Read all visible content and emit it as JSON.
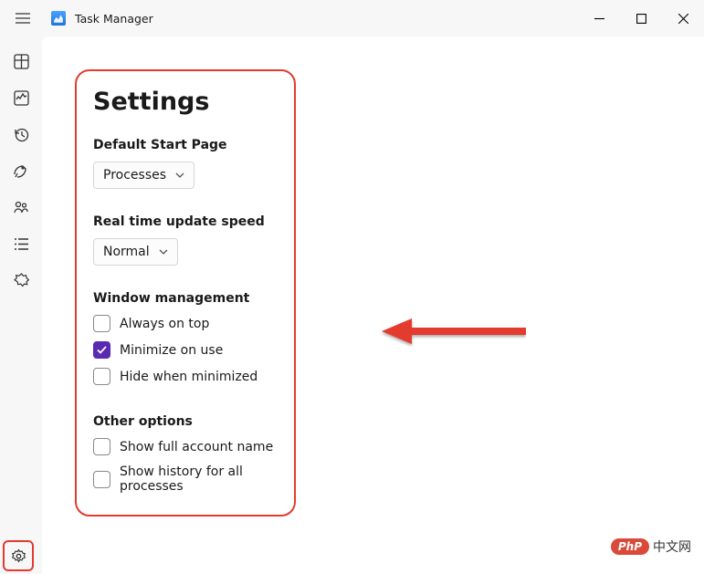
{
  "title": "Task Manager",
  "settings": {
    "heading": "Settings",
    "defaultStart": {
      "label": "Default Start Page",
      "value": "Processes"
    },
    "updateSpeed": {
      "label": "Real time update speed",
      "value": "Normal"
    },
    "windowMgmt": {
      "label": "Window management",
      "alwaysOnTop": {
        "label": "Always on top",
        "checked": false
      },
      "minimizeOnUse": {
        "label": "Minimize on use",
        "checked": true
      },
      "hideWhenMin": {
        "label": "Hide when minimized",
        "checked": false
      }
    },
    "other": {
      "label": "Other options",
      "fullAccount": {
        "label": "Show full account name",
        "checked": false
      },
      "showHistory": {
        "label": "Show history for all processes",
        "checked": false
      }
    }
  },
  "watermark": {
    "badge": "PhP",
    "text": "中文网"
  }
}
